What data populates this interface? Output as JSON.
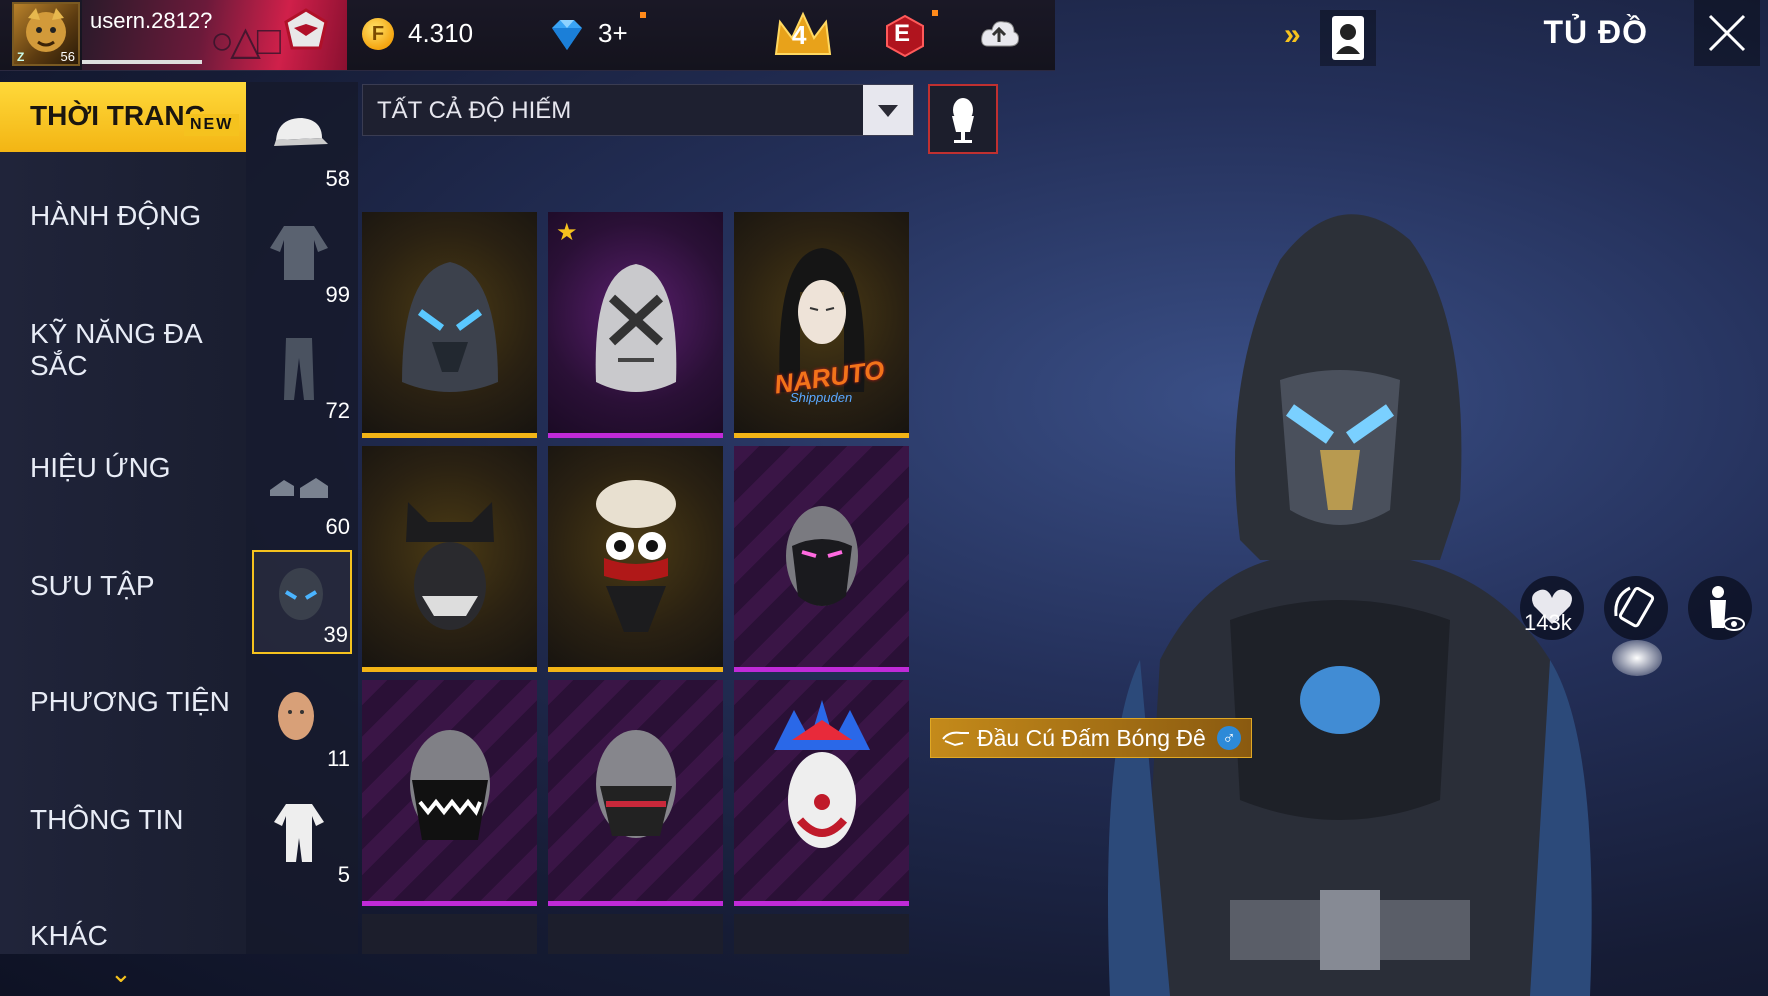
{
  "player": {
    "username": "usern.2812?",
    "level": "56"
  },
  "resources": {
    "gold": "4.310",
    "diamonds": "3+",
    "rank_number": "4",
    "event_letter": "E"
  },
  "header": {
    "title": "TỦ ĐỒ"
  },
  "nav": {
    "items": [
      {
        "label": "THỜI TRANG",
        "active": true
      },
      {
        "label": "HÀNH ĐỘNG",
        "badge": "NEW"
      },
      {
        "label": "KỸ NĂNG ĐA SẮC"
      },
      {
        "label": "HIỆU ỨNG"
      },
      {
        "label": "SƯU TẬP"
      },
      {
        "label": "PHƯƠNG TIỆN"
      },
      {
        "label": "THÔNG TIN"
      },
      {
        "label": "KHÁC"
      }
    ]
  },
  "categories": [
    {
      "icon": "cap-icon",
      "count": "58"
    },
    {
      "icon": "top-icon",
      "count": "99"
    },
    {
      "icon": "pants-icon",
      "count": "72"
    },
    {
      "icon": "shoes-icon",
      "count": "60"
    },
    {
      "icon": "head-icon",
      "count": "39",
      "active": true
    },
    {
      "icon": "face-icon",
      "count": "11"
    },
    {
      "icon": "outfit-icon",
      "count": "5"
    }
  ],
  "filter": {
    "label": "TẤT CẢ ĐỘ HIẾM"
  },
  "grid": {
    "tiles": [
      {
        "rarity": "gold",
        "name": "hood-mask-icon"
      },
      {
        "rarity": "purple",
        "name": "skull-mask-icon",
        "starred": true
      },
      {
        "rarity": "gold",
        "name": "naruto-orochimaru-icon",
        "logo": "NARUTO",
        "logo_sub": "Shippuden"
      },
      {
        "rarity": "gold",
        "name": "cat-beanie-icon"
      },
      {
        "rarity": "gold",
        "name": "clown-hat-icon"
      },
      {
        "rarity": "purple",
        "name": "pink-eye-mask-icon"
      },
      {
        "rarity": "purple",
        "name": "teeth-mask-icon"
      },
      {
        "rarity": "purple",
        "name": "fang-mask-icon"
      },
      {
        "rarity": "purple",
        "name": "clown-mask-icon"
      }
    ]
  },
  "selected_item": {
    "name": "Đầu Cú Đấm Bóng Đê",
    "gender_symbol": "♂"
  },
  "preview": {
    "likes": "143k"
  },
  "colors": {
    "accent": "#f5c21e",
    "legendary": "#f2b416",
    "epic": "#c02ad8"
  }
}
